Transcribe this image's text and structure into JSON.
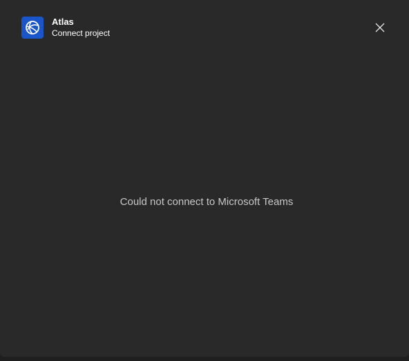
{
  "header": {
    "app_name": "Atlas",
    "subtitle": "Connect project",
    "app_icon": "atlas-globe-icon",
    "close_icon": "close-icon"
  },
  "main": {
    "message": "Could not connect to Microsoft Teams"
  },
  "colors": {
    "dialog_background": "#292929",
    "app_icon_background": "#1a56c9",
    "text_primary": "#ffffff",
    "text_secondary": "#c8c8c8"
  }
}
